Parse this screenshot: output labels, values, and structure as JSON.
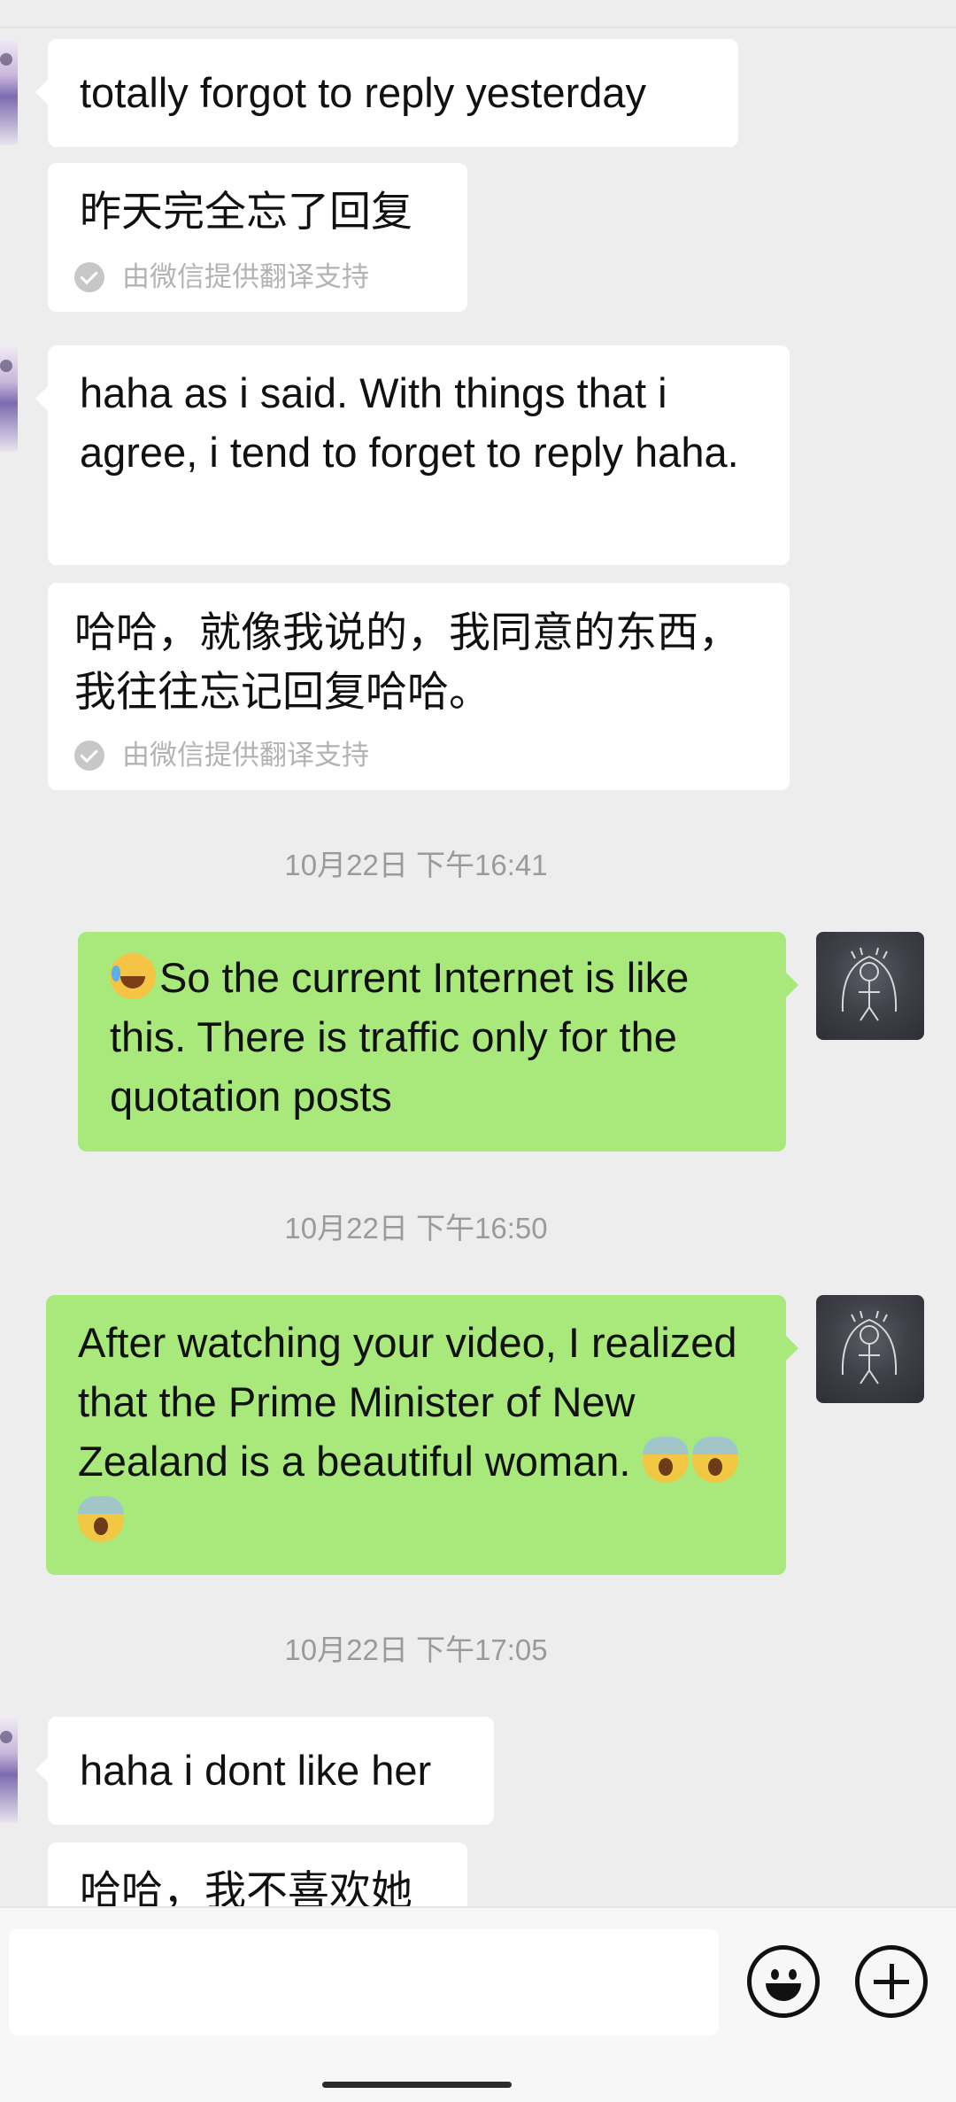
{
  "messages": [
    {
      "text": "totally forgot to reply yesterday"
    },
    {
      "text": "昨天完全忘了回复",
      "note": "由微信提供翻译支持"
    },
    {
      "text": "haha as i said. With things that i agree, i tend to forget to reply haha."
    },
    {
      "text": "哈哈，就像我说的，我同意的东西，我往往忘记回复哈哈。",
      "note": "由微信提供翻译支持"
    },
    {
      "time": "10月22日 下午16:41"
    },
    {
      "text": "So the current Internet is like this. There is traffic only for the quotation posts"
    },
    {
      "time": "10月22日 下午16:50"
    },
    {
      "text": "After watching your video, I realized that the Prime Minister of New Zealand is a beautiful woman."
    },
    {
      "time": "10月22日 下午17:05"
    },
    {
      "text": "haha i dont like her"
    },
    {
      "text": "哈哈，我不喜欢她"
    }
  ],
  "icons": {
    "emoji_laugh_cry": "laughing-crying-emoji",
    "emoji_scream": "screaming-emoji",
    "emoji_button": "smiley-face-icon",
    "more_button": "plus-circle-icon",
    "translation_check": "check-circle-icon"
  },
  "input": {
    "value": "",
    "placeholder": ""
  },
  "colors": {
    "background": "#ededed",
    "incoming_bubble": "#ffffff",
    "outgoing_bubble": "#a9e87a",
    "timestamp_text": "#9a9a9a"
  }
}
